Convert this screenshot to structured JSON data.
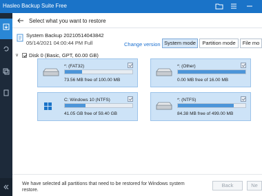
{
  "window": {
    "title": "Hasleo Backup Suite Free"
  },
  "sidebar": {
    "items": [
      {
        "label": "Backup",
        "icon": "backup-icon"
      },
      {
        "label": "Restore",
        "icon": "restore-icon"
      },
      {
        "label": "Clone",
        "icon": "clone-icon"
      },
      {
        "label": "Tools",
        "icon": "tools-icon"
      }
    ],
    "collapse_icon": "double-chevron-left-icon"
  },
  "header": {
    "title": "Select what you want to restore"
  },
  "backup": {
    "name": "System Backup 20210514043842",
    "date": "05/14/2021 04:00:44 PM Full",
    "change_version_label": "Change version"
  },
  "modes": [
    {
      "label": "System mode",
      "selected": true
    },
    {
      "label": "Partition mode",
      "selected": false
    },
    {
      "label": "File mo",
      "selected": false
    }
  ],
  "disk": {
    "label": "Disk 0 (Basic, GPT, 60.00 GB)"
  },
  "partitions": [
    {
      "name": "*: (FAT32)",
      "free": "73.56 MB free of 100.00 MB",
      "used_fraction": 0.26,
      "icon": "drive-icon"
    },
    {
      "name": "*: (Other)",
      "free": "0.00 MB free of 16.00 MB",
      "used_fraction": 1.0,
      "icon": "drive-icon"
    },
    {
      "name": "C: Windows 10 (NTFS)",
      "free": "41.05 GB free of 59.40 GB",
      "used_fraction": 0.31,
      "icon": "windows-drive-icon"
    },
    {
      "name": "*: (NTFS)",
      "free": "84.38 MB free of 499.00 MB",
      "used_fraction": 0.83,
      "icon": "drive-icon"
    }
  ],
  "footer": {
    "message": "We have selected all partitions that need to be restored for Windows system restore.",
    "back_label": "Back",
    "next_label": "Ne"
  },
  "colors": {
    "titlebar": "#1a73c8",
    "sidebar": "#1d2a3a",
    "accent": "#2a87d6",
    "card": "#cde3f7",
    "bar_fill": "#4c95d9",
    "link": "#1a6fd0"
  }
}
